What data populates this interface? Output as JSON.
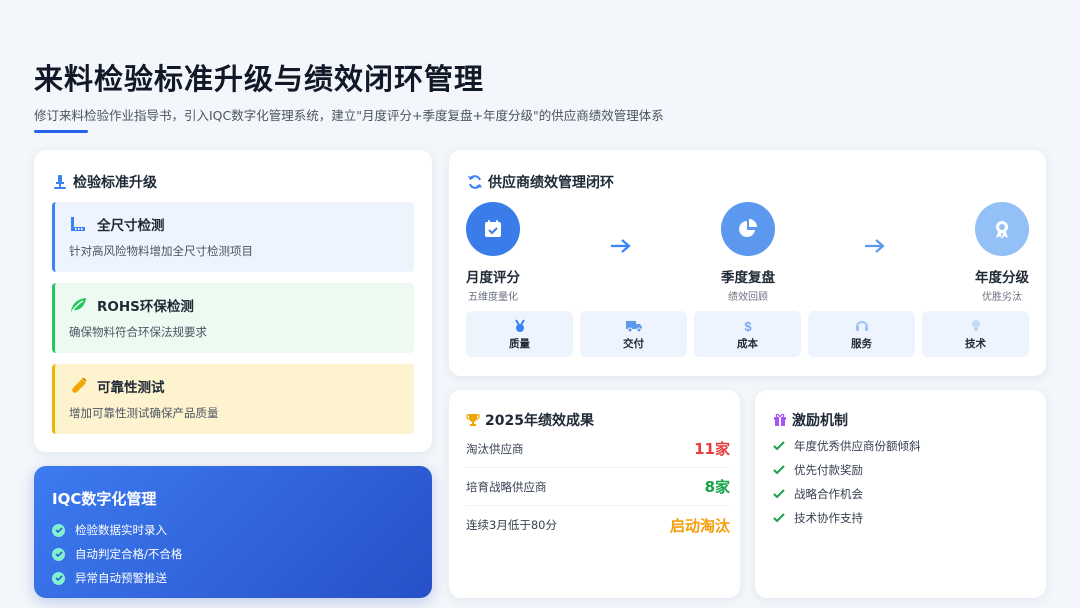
{
  "header": {
    "title": "来料检验标准升级与绩效闭环管理",
    "subtitle": "修订来料检验作业指导书，引入IQC数字化管理系统，建立\"月度评分+季度复盘+年度分级\"的供应商绩效管理体系"
  },
  "standard": {
    "title": "检验标准升级",
    "items": [
      {
        "label": "全尺寸检测",
        "desc": "针对高风险物料增加全尺寸检测项目",
        "icon": "ruler-icon"
      },
      {
        "label": "ROHS环保检测",
        "desc": "确保物料符合环保法规要求",
        "icon": "leaf-icon"
      },
      {
        "label": "可靠性测试",
        "desc": "增加可靠性测试确保产品质量",
        "icon": "flask-icon"
      }
    ]
  },
  "iqc": {
    "title": "IQC数字化管理",
    "items": [
      "检验数据实时录入",
      "自动判定合格/不合格",
      "异常自动预警推送"
    ]
  },
  "loop": {
    "title": "供应商绩效管理闭环",
    "stages": [
      {
        "label": "月度评分",
        "sub": "五维度量化",
        "icon": "calendar-check-icon"
      },
      {
        "label": "季度复盘",
        "sub": "绩效回顾",
        "icon": "pie-chart-icon"
      },
      {
        "label": "年度分级",
        "sub": "优胜劣汰",
        "icon": "award-icon"
      }
    ],
    "dimensions": [
      {
        "label": "质量",
        "icon": "medal-icon"
      },
      {
        "label": "交付",
        "icon": "truck-icon"
      },
      {
        "label": "成本",
        "icon": "dollar-icon"
      },
      {
        "label": "服务",
        "icon": "headset-icon"
      },
      {
        "label": "技术",
        "icon": "lightbulb-icon"
      }
    ]
  },
  "results": {
    "title": "2025年绩效成果",
    "rows": [
      {
        "label": "淘汰供应商",
        "value": "11家",
        "color": "#e53e3e"
      },
      {
        "label": "培育战略供应商",
        "value": "8家",
        "color": "#16a34a"
      },
      {
        "label": "连续3月低于80分",
        "value": "启动淘汰",
        "color": "#f59e0b"
      }
    ]
  },
  "incentive": {
    "title": "激励机制",
    "items": [
      "年度优秀供应商份额倾斜",
      "优先付款奖励",
      "战略合作机会",
      "技术协作支持"
    ]
  },
  "colors": {
    "accent": "#2563eb",
    "green": "#22c55e",
    "yellow": "#f0b400",
    "red": "#e53e3e"
  }
}
